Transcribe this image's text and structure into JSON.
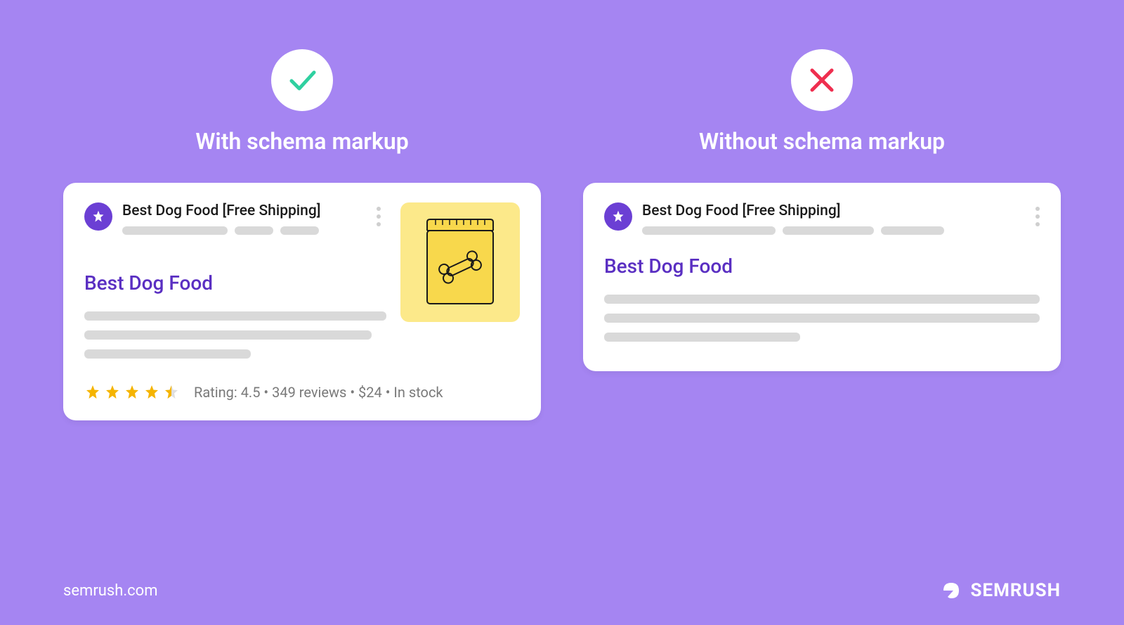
{
  "left": {
    "heading": "With schema markup",
    "result_title": "Best Dog Food [Free Shipping]",
    "link_title": "Best Dog Food",
    "rating_text": "Rating: 4.5 • 349 reviews • $24 • In stock",
    "rating_value": 4.5
  },
  "right": {
    "heading": "Without schema markup",
    "result_title": "Best Dog Food [Free Shipping]",
    "link_title": "Best Dog Food"
  },
  "footer": {
    "url": "semrush.com",
    "brand": "SEMRUSH"
  }
}
